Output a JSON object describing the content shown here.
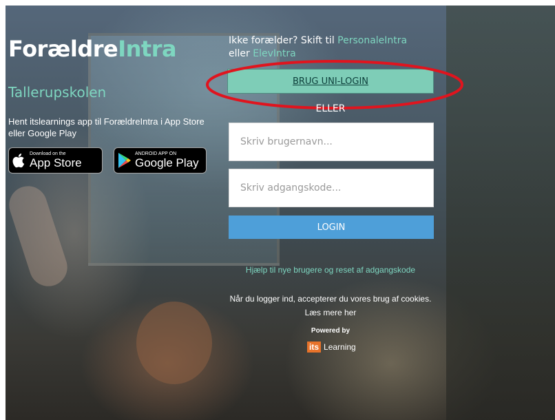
{
  "brand": {
    "part1": "Forældre",
    "part2": "Intra"
  },
  "school_name": "Tallerupskolen",
  "app_text": "Hent itslearnings app til ForældreIntra i App Store eller Google Play",
  "app_store": {
    "small": "Download on the",
    "big": "App Store",
    "icon": "apple-icon"
  },
  "google_play": {
    "small": "ANDROID APP ON",
    "big": "Google Play",
    "icon": "google-play-icon"
  },
  "switch_text": {
    "prefix": "Ikke forælder? Skift til",
    "link1": "PersonaleIntra",
    "middle": "eller",
    "link2": "ElevIntra"
  },
  "uni_login_button": "BRUG UNI-LOGIN",
  "divider_text": "ELLER",
  "username": {
    "placeholder": "Skriv brugernavn...",
    "value": ""
  },
  "password": {
    "placeholder": "Skriv adgangskode...",
    "value": ""
  },
  "login_button": "LOGIN",
  "help_link": "Hjælp til nye brugere og reset af adgangskode",
  "cookies_text": "Når du logger ind, accepterer du vores brug af cookies. Læs mere her",
  "powered_by": "Powered by",
  "itslearning": {
    "its": "its",
    "learning": "Learning"
  },
  "colors": {
    "accent": "#7ed6c0",
    "uni_button": "#7ecdb7",
    "login_button": "#4e9fd9",
    "annotation_red": "#e0141e"
  }
}
